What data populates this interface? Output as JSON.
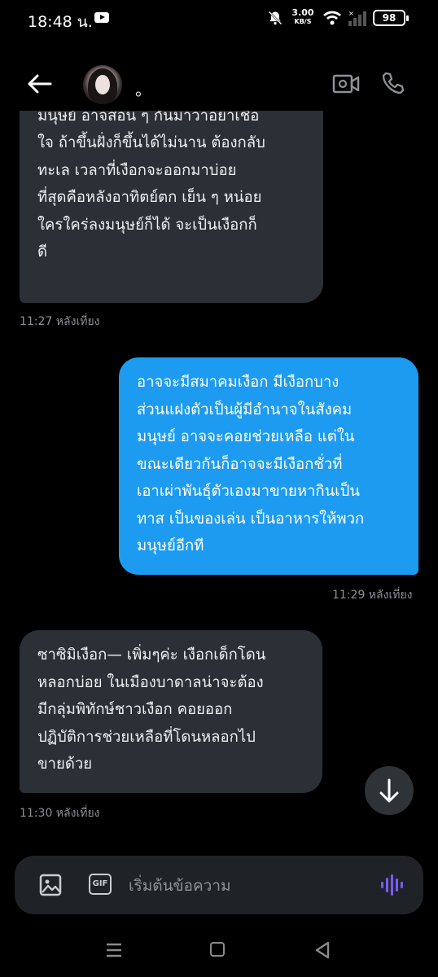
{
  "status_bar": {
    "time": "18:48 น.",
    "net_speed_value": "3.00",
    "net_speed_unit": "KB/S",
    "battery": "98"
  },
  "header": {
    "contact_name": "。",
    "icons": [
      "back-arrow-icon",
      "video-call-icon",
      "phone-call-icon"
    ]
  },
  "messages": [
    {
      "direction": "incoming",
      "lines": [
        "มนุษย์ อาจสอน ๆ กันมาว่าอย่าเชื่อ",
        "ใจ ถ้าขึ้นฝั่งก็ขึ้นได้ไม่นาน ต้องกลับ",
        "ทะเล เวลาที่เงือกจะออกมาบ่อย",
        "ที่สุดคือหลังอาทิตย์ตก เย็น ๆ หน่อย",
        "ใครใคร่ลงมนุษย์ก็ได้ จะเป็นเงือกก็",
        "ดี"
      ],
      "time": "11:27 หลังเที่ยง"
    },
    {
      "direction": "outgoing",
      "lines": [
        "อาจจะมีสมาคมเงือก มีเงือกบาง",
        "ส่วนแฝงตัวเป็นผู้มีอำนาจในสังคม",
        "มนุษย์ อาจจะคอยช่วยเหลือ แต่ใน",
        "ขณะเดียวกันก็อาจจะมีเงือกชั่วที่",
        "เอาเผ่าพันธุ์ตัวเองมาขายหากินเป็น",
        "ทาส เป็นของเล่น เป็นอาหารให้พวก",
        "มนุษย์อีกที"
      ],
      "time": "11:29 หลังเที่ยง"
    },
    {
      "direction": "incoming",
      "lines": [
        "ซาซิมิเงือก— เพิ่มๆค่ะ เงือกเด็กโดน",
        "หลอกบ่อย ในเมืองบาดาลน่าจะต้อง",
        "มีกลุ่มพิทักษ์ชาวเงือก คอยออก",
        "ปฏิบัติการช่วยเหลือที่โดนหลอกไป",
        "ขายด้วย"
      ],
      "time": "11:30 หลังเที่ยง"
    }
  ],
  "composer": {
    "placeholder": "เริ่มต้นข้อความ",
    "gif_label": "GIF",
    "icons": [
      "image-icon",
      "gif-icon",
      "voice-message-icon"
    ]
  },
  "colors": {
    "background": "#000000",
    "incoming_bubble": "#2b2f36",
    "outgoing_bubble": "#1d9bf0",
    "timestamp": "#8b9096",
    "voice_accent": "#7b5cff"
  }
}
